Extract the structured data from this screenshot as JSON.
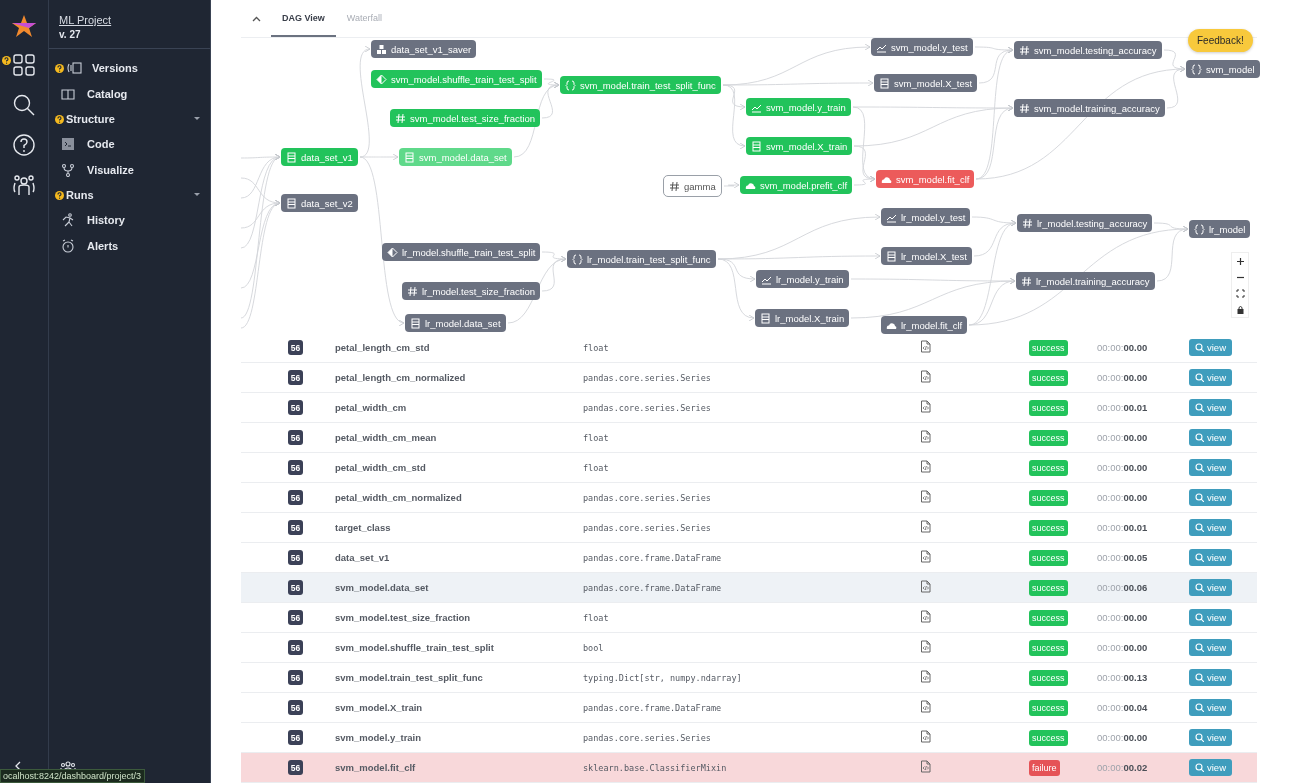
{
  "project": {
    "name": "ML Project",
    "version": "v. 27"
  },
  "rail": [
    {
      "help": true
    },
    {
      "help": false
    },
    {
      "help": false
    },
    {
      "help": false
    }
  ],
  "nav": [
    {
      "kind": "item",
      "label": "Versions",
      "help": true
    },
    {
      "kind": "item",
      "label": "Catalog",
      "help": false
    },
    {
      "kind": "section",
      "label": "Structure",
      "help": true,
      "expanded": true
    },
    {
      "kind": "item",
      "label": "Code",
      "help": false
    },
    {
      "kind": "item",
      "label": "Visualize",
      "help": false
    },
    {
      "kind": "section",
      "label": "Runs",
      "help": true,
      "expanded": true
    },
    {
      "kind": "item",
      "label": "History",
      "help": false
    },
    {
      "kind": "item",
      "label": "Alerts",
      "help": false
    }
  ],
  "tabs": [
    {
      "label": "DAG View",
      "selected": true
    },
    {
      "label": "Waterfall",
      "selected": false
    }
  ],
  "feedback": "Feedback!",
  "dag": {
    "nodes": [
      {
        "label": "data_set_v1",
        "kind": "success",
        "highlighted": false
      },
      {
        "label": "data_set_v2",
        "kind": "idle",
        "highlighted": false
      },
      {
        "label": "data_set_v1_saver",
        "kind": "idle",
        "highlighted": false
      },
      {
        "label": "svm_model.shuffle_train_test_split",
        "kind": "success",
        "highlighted": false
      },
      {
        "label": "svm_model.test_size_fraction",
        "kind": "success",
        "highlighted": false
      },
      {
        "label": "svm_model.data_set",
        "kind": "success",
        "highlighted": true
      },
      {
        "label": "lr_model.shuffle_train_test_split",
        "kind": "idle",
        "highlighted": false
      },
      {
        "label": "lr_model.test_size_fraction",
        "kind": "idle",
        "highlighted": false
      },
      {
        "label": "lr_model.data_set",
        "kind": "idle",
        "highlighted": false
      },
      {
        "label": "svm_model.train_test_split_func",
        "kind": "success",
        "highlighted": false
      },
      {
        "label": "gamma",
        "kind": "input",
        "highlighted": false
      },
      {
        "label": "lr_model.train_test_split_func",
        "kind": "idle",
        "highlighted": false
      },
      {
        "label": "svm_model.y_train",
        "kind": "success",
        "highlighted": false
      },
      {
        "label": "svm_model.X_train",
        "kind": "success",
        "highlighted": false
      },
      {
        "label": "svm_model.prefit_clf",
        "kind": "success",
        "highlighted": false
      },
      {
        "label": "lr_model.y_train",
        "kind": "idle",
        "highlighted": false
      },
      {
        "label": "lr_model.X_train",
        "kind": "idle",
        "highlighted": false
      },
      {
        "label": "svm_model.y_test",
        "kind": "idle",
        "highlighted": false
      },
      {
        "label": "svm_model.X_test",
        "kind": "idle",
        "highlighted": false
      },
      {
        "label": "svm_model.fit_clf",
        "kind": "failure",
        "highlighted": false
      },
      {
        "label": "lr_model.y_test",
        "kind": "idle",
        "highlighted": false
      },
      {
        "label": "lr_model.X_test",
        "kind": "idle",
        "highlighted": false
      },
      {
        "label": "lr_model.fit_clf",
        "kind": "idle",
        "highlighted": false
      },
      {
        "label": "svm_model.testing_accuracy",
        "kind": "idle",
        "highlighted": false
      },
      {
        "label": "svm_model.training_accuracy",
        "kind": "idle",
        "highlighted": false
      },
      {
        "label": "lr_model.testing_accuracy",
        "kind": "idle",
        "highlighted": false
      },
      {
        "label": "lr_model.training_accuracy",
        "kind": "idle",
        "highlighted": false
      },
      {
        "label": "svm_model",
        "kind": "idle",
        "highlighted": false
      },
      {
        "label": "lr_model",
        "kind": "idle",
        "highlighted": false
      }
    ]
  },
  "rows": [
    {
      "run": "56",
      "name": "petal_length_cm_std",
      "type": "float",
      "status": "success",
      "failed": false,
      "time": "00:00:**00.00**",
      "action": "view",
      "highlighted": false
    },
    {
      "run": "56",
      "name": "petal_length_cm_normalized",
      "type": "pandas.core.series.Series",
      "status": "success",
      "failed": false,
      "time": "00:00:**00.00**",
      "action": "view",
      "highlighted": false
    },
    {
      "run": "56",
      "name": "petal_width_cm",
      "type": "pandas.core.series.Series",
      "status": "success",
      "failed": false,
      "time": "00:00:**00.01**",
      "action": "view",
      "highlighted": false
    },
    {
      "run": "56",
      "name": "petal_width_cm_mean",
      "type": "float",
      "status": "success",
      "failed": false,
      "time": "00:00:**00.00**",
      "action": "view",
      "highlighted": false
    },
    {
      "run": "56",
      "name": "petal_width_cm_std",
      "type": "float",
      "status": "success",
      "failed": false,
      "time": "00:00:**00.00**",
      "action": "view",
      "highlighted": false
    },
    {
      "run": "56",
      "name": "petal_width_cm_normalized",
      "type": "pandas.core.series.Series",
      "status": "success",
      "failed": false,
      "time": "00:00:**00.00**",
      "action": "view",
      "highlighted": false
    },
    {
      "run": "56",
      "name": "target_class",
      "type": "pandas.core.series.Series",
      "status": "success",
      "failed": false,
      "time": "00:00:**00.01**",
      "action": "view",
      "highlighted": false
    },
    {
      "run": "56",
      "name": "data_set_v1",
      "type": "pandas.core.frame.DataFrame",
      "status": "success",
      "failed": false,
      "time": "00:00:**00.05**",
      "action": "view",
      "highlighted": false
    },
    {
      "run": "56",
      "name": "svm_model.data_set",
      "type": "pandas.core.frame.DataFrame",
      "status": "success",
      "failed": false,
      "time": "00:00:**00.06**",
      "action": "view",
      "highlighted": true
    },
    {
      "run": "56",
      "name": "svm_model.test_size_fraction",
      "type": "float",
      "status": "success",
      "failed": false,
      "time": "00:00:**00.00**",
      "action": "view",
      "highlighted": false
    },
    {
      "run": "56",
      "name": "svm_model.shuffle_train_test_split",
      "type": "bool",
      "status": "success",
      "failed": false,
      "time": "00:00:**00.00**",
      "action": "view",
      "highlighted": false
    },
    {
      "run": "56",
      "name": "svm_model.train_test_split_func",
      "type": "typing.Dict[str, numpy.ndarray]",
      "status": "success",
      "failed": false,
      "time": "00:00:**00.13**",
      "action": "view",
      "highlighted": false
    },
    {
      "run": "56",
      "name": "svm_model.X_train",
      "type": "pandas.core.frame.DataFrame",
      "status": "success",
      "failed": false,
      "time": "00:00:**00.04**",
      "action": "view",
      "highlighted": false
    },
    {
      "run": "56",
      "name": "svm_model.y_train",
      "type": "pandas.core.series.Series",
      "status": "success",
      "failed": false,
      "time": "00:00:**00.00**",
      "action": "view",
      "highlighted": false
    },
    {
      "run": "56",
      "name": "svm_model.fit_clf",
      "type": "sklearn.base.ClassifierMixin",
      "status": "failure",
      "failed": true,
      "time": "00:00:**00.02**",
      "action": "view",
      "highlighted": false
    }
  ],
  "status_url": "ocalhost:8242/dashboard/project/3"
}
